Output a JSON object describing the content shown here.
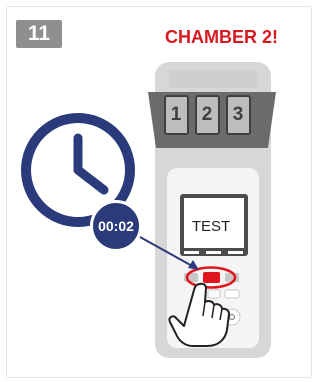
{
  "step": {
    "number": "11"
  },
  "header": {
    "title": "CHAMBER 2!"
  },
  "device": {
    "chamber_labels": [
      "1",
      "2",
      "3"
    ],
    "display_text": "TEST",
    "highlighted_button": "chamber-2"
  },
  "timer": {
    "value": "00:02"
  },
  "colors": {
    "title_red": "#d71920",
    "badge_gray": "#8f8f8f",
    "clock_blue": "#2b3a7a",
    "device_gray": "#d7d7d7",
    "highlight_red": "#e0141c"
  },
  "icons": [
    "clock-icon",
    "hand-pointer-icon",
    "arrow-icon"
  ]
}
